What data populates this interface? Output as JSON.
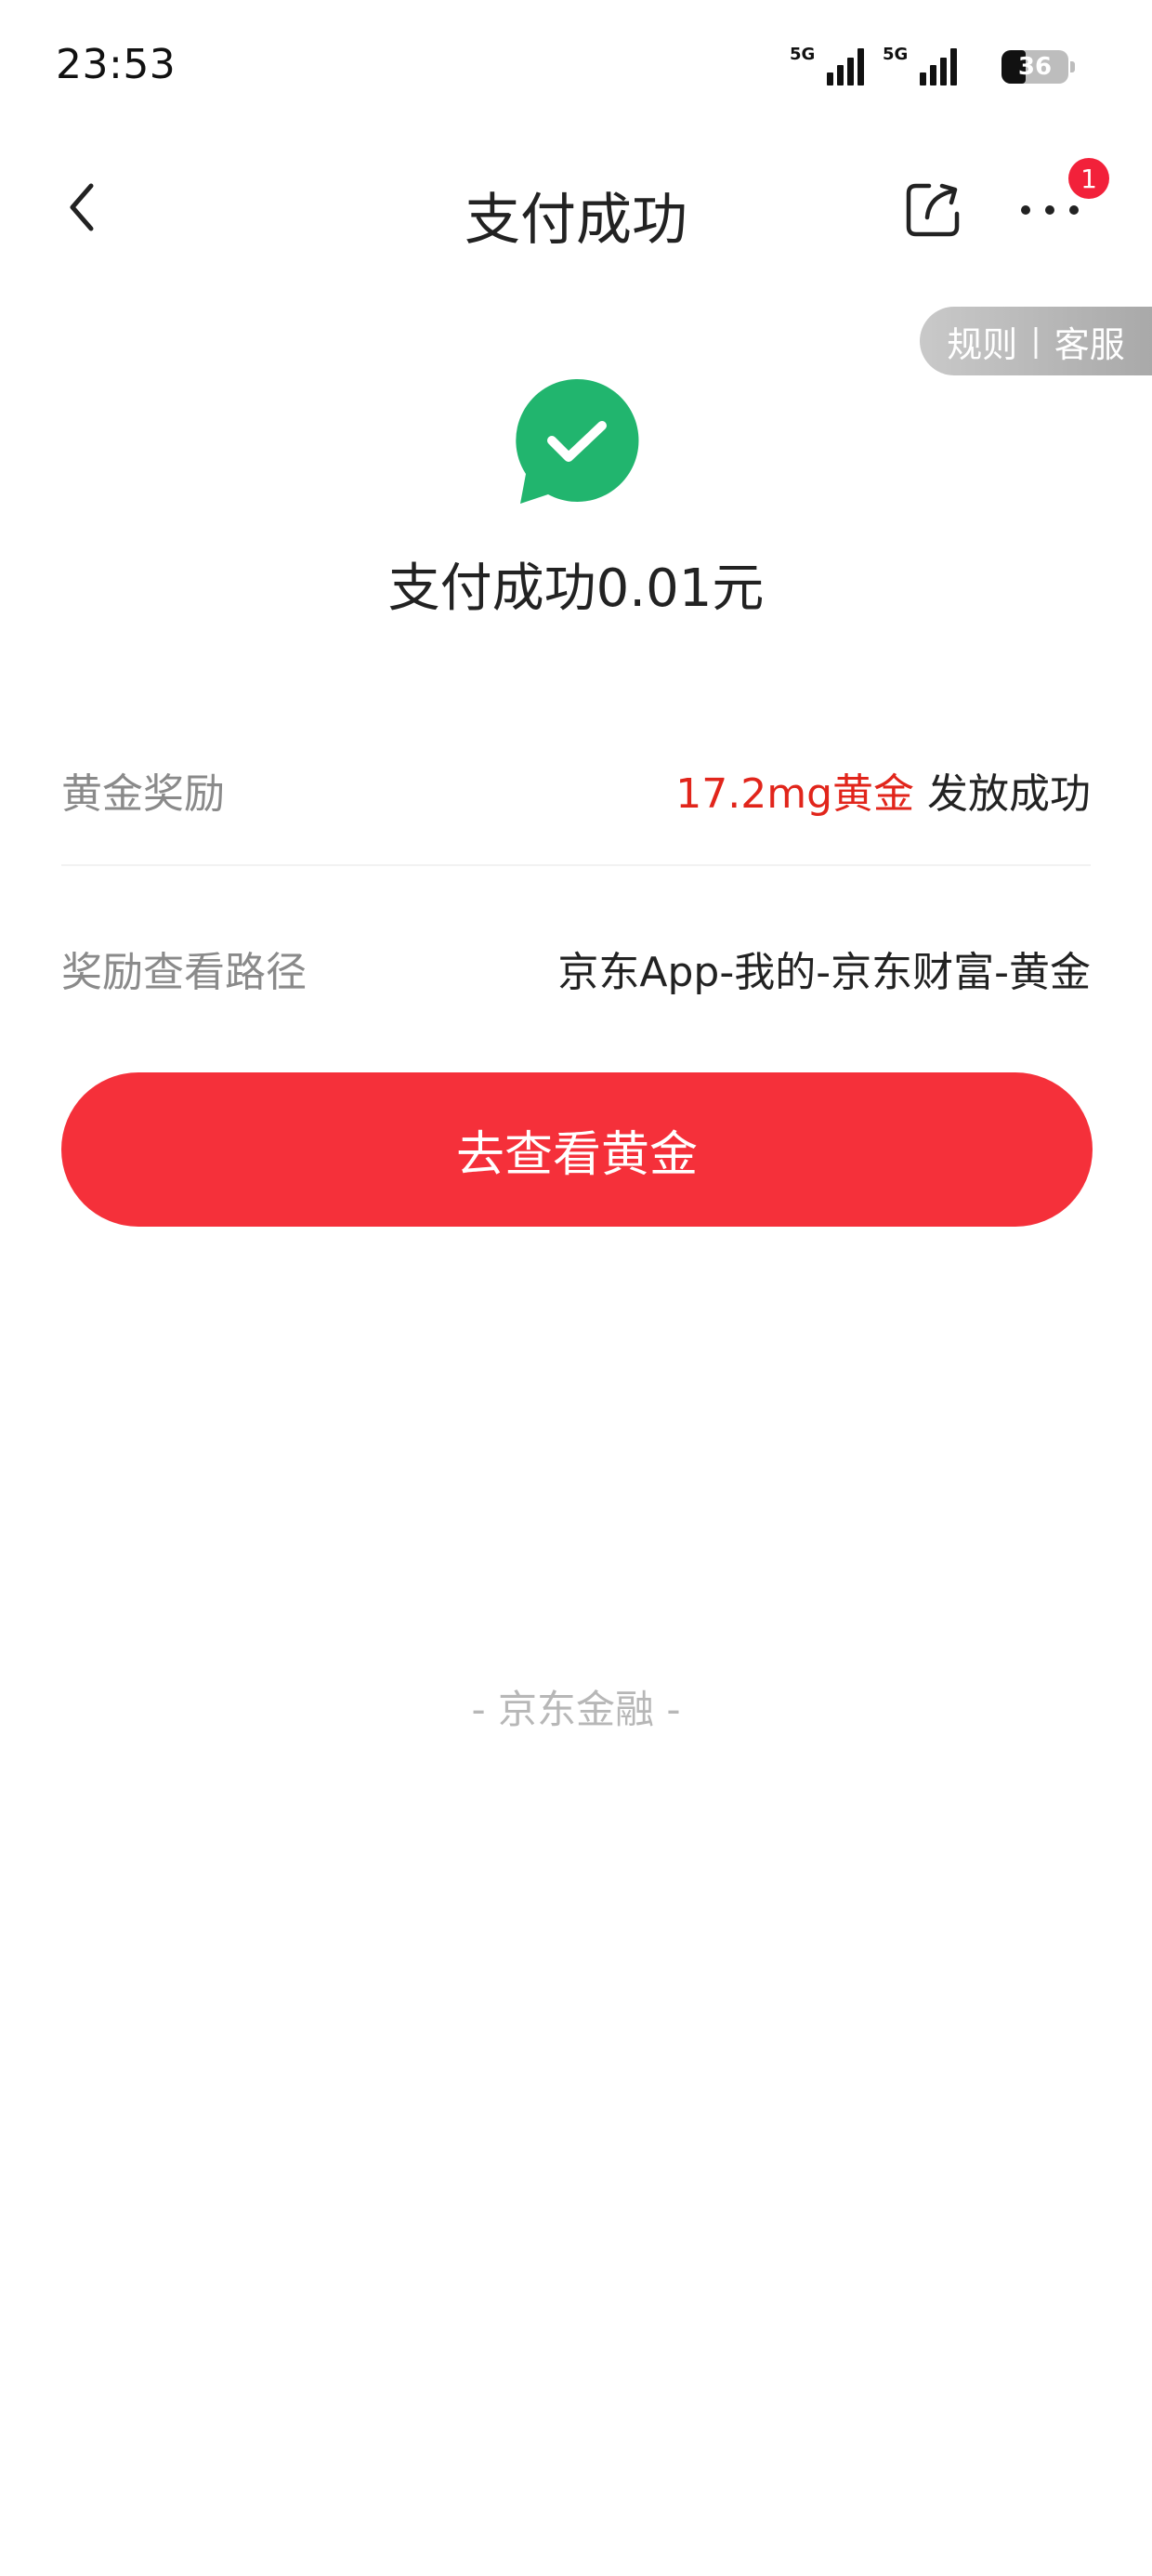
{
  "status_bar": {
    "time": "23:53",
    "signal1_label": "5G",
    "signal2_label": "5G",
    "battery": "36",
    "battery_level": 0.36
  },
  "nav": {
    "title": "支付成功",
    "more_badge": "1"
  },
  "rules_link": {
    "rules": "规则",
    "separator": "|",
    "service": "客服"
  },
  "success": {
    "amount_text": "支付成功0.01元",
    "icon_color": "#21b56e"
  },
  "rows": {
    "reward_label": "黄金奖励",
    "reward_amount": "17.2mg黄金",
    "reward_status": " 发放成功",
    "path_label": "奖励查看路径",
    "path_value": "京东App-我的-京东财富-黄金"
  },
  "primary_button": {
    "label": "去查看黄金"
  },
  "footer": {
    "brand": "- 京东金融 -"
  },
  "colors": {
    "accent_red": "#f5303a",
    "highlight_red": "#e1251b",
    "success_green": "#21b56e"
  }
}
